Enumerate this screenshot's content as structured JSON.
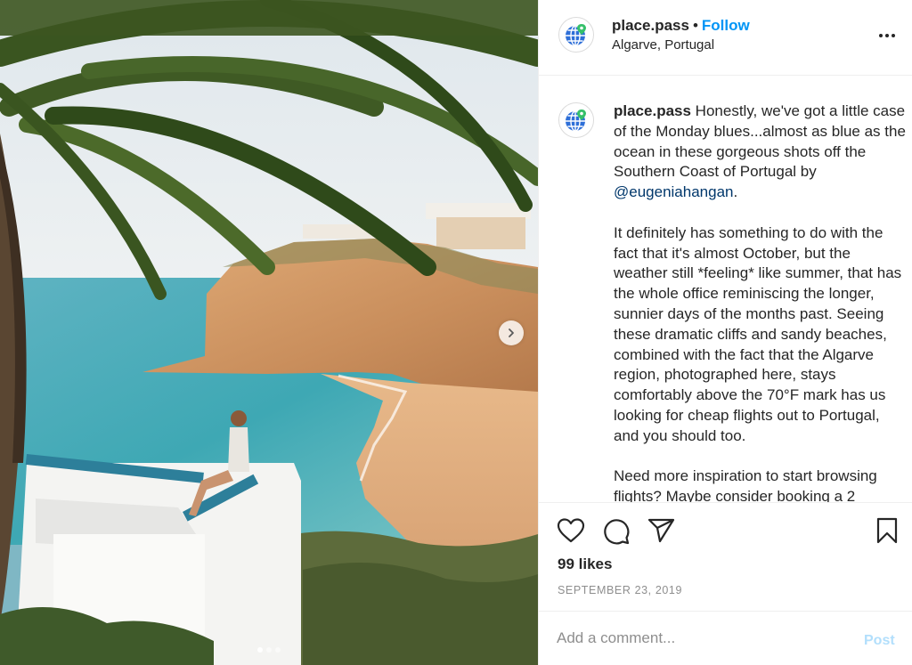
{
  "post": {
    "username": "place.pass",
    "separator": "•",
    "follow_label": "Follow",
    "location": "Algarve, Portugal",
    "avatar_icon": "globe-location-icon",
    "photo_description_icon": "photo",
    "carousel": {
      "total": 3,
      "current": 1
    }
  },
  "caption": {
    "username": "place.pass",
    "p1_before": " Honestly, we've got a little case of the Monday blues...almost as blue as the ocean in these gorgeous shots off the Southern Coast of Portugal by ",
    "mention": "@eugeniahangan",
    "p1_after": ".",
    "p2": "It definitely has something to do with the fact that it's almost October, but the weather still *feeling* like summer, that has the whole office reminiscing the longer, sunnier days of the months past. Seeing these dramatic cliffs and sandy beaches, combined with the fact that the Algarve region, photographed here, stays comfortably above the 70°F mark has us looking for cheap flights out to Portugal, and you should too.",
    "p3": "Need more inspiration to start browsing flights? Maybe consider booking a 2"
  },
  "actions": {
    "icons": [
      "heart-icon",
      "comment-icon",
      "share-icon",
      "bookmark-icon"
    ],
    "likes": "99 likes",
    "date": "SEPTEMBER 23, 2019"
  },
  "comment_box": {
    "placeholder": "Add a comment...",
    "post_label": "Post"
  },
  "colors": {
    "link_blue": "#0095f6",
    "post_disabled": "#b2dffc",
    "mention": "#00376b",
    "muted": "#8e8e8e",
    "divider": "#efefef"
  }
}
